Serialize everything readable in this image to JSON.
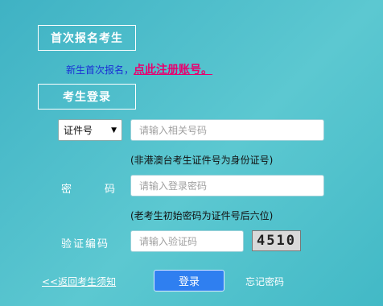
{
  "first_signup": {
    "title": "首次报名考生",
    "new_text": "新生首次报名",
    "comma": "，",
    "register_link": "点此注册账号。"
  },
  "login": {
    "title": "考生登录",
    "id_type_selected": "证件号",
    "id_placeholder": "请输入相关号码",
    "id_hint": "(非港澳台考生证件号为身份证号)",
    "password_label_char1": "密",
    "password_label_char2": "码",
    "password_placeholder": "请输入登录密码",
    "password_hint": "(老考生初始密码为证件号后六位)",
    "captcha_label": "验证编码",
    "captcha_placeholder": "请输入验证码",
    "captcha_code": "4510",
    "back_link": "<<返回考生须知",
    "login_button": "登录",
    "forgot_link": "忘记密码"
  },
  "colors": {
    "background": "#4fc0cc",
    "link_pink": "#e8006f",
    "text_blue": "#1a2fd6",
    "button_blue": "#2f7ff0"
  }
}
